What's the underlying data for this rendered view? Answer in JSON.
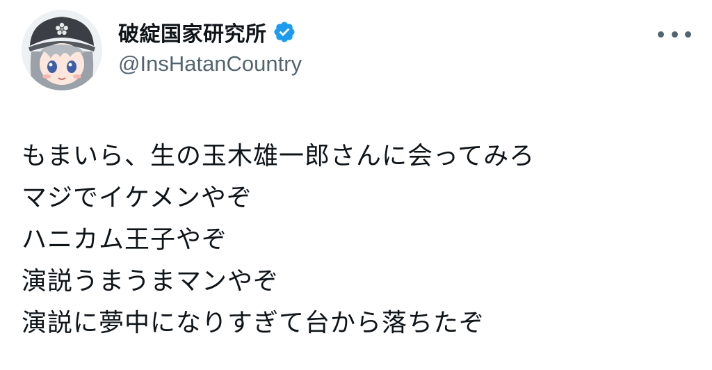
{
  "author": {
    "display_name": "破綻国家研究所",
    "handle": "@InsHatanCountry",
    "verified_icon": "verified-badge-icon",
    "avatar_icon": "anime-girl-avatar"
  },
  "more_icon": "more-options-icon",
  "tweet_lines": [
    "もまいら、生の玉木雄一郎さんに会ってみろ",
    "マジでイケメンやぞ",
    "ハニカム王子やぞ",
    "演説うまうまマンやぞ",
    "演説に夢中になりすぎて台から落ちたぞ"
  ],
  "colors": {
    "text": "#0f1419",
    "secondary": "#536471",
    "verified": "#1d9bf0"
  }
}
